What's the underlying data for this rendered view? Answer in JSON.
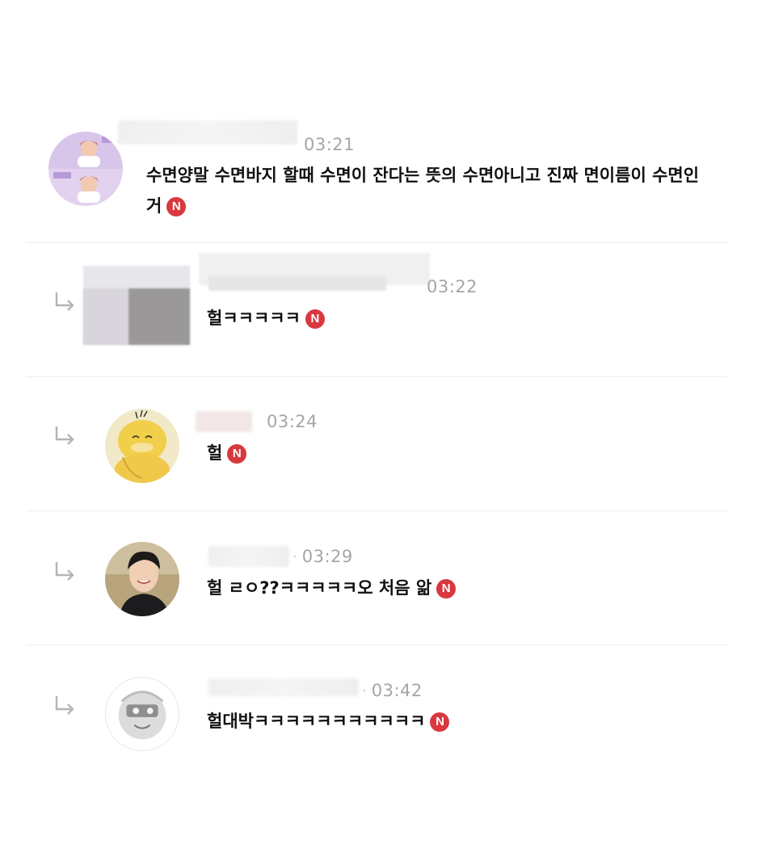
{
  "new_badge_label": "N",
  "comments": [
    {
      "time": "03:21",
      "text": "수면양말 수면바지 할때 수면이 잔다는 뜻의 수면아니고 진짜 면이름이 수면인거"
    },
    {
      "time": "03:22",
      "text": "헐ㅋㅋㅋㅋㅋ"
    },
    {
      "time": "03:24",
      "text": "헐"
    },
    {
      "time": "03:29",
      "text": "헐 ㄹㅇ??ㅋㅋㅋㅋㅋ오 처음 앎"
    },
    {
      "time": "03:42",
      "text": "헐대박ㅋㅋㅋㅋㅋㅋㅋㅋㅋㅋㅋ"
    }
  ],
  "colors": {
    "badge": "#d9383f",
    "time": "#a6a6a6",
    "divider": "#ececec"
  }
}
